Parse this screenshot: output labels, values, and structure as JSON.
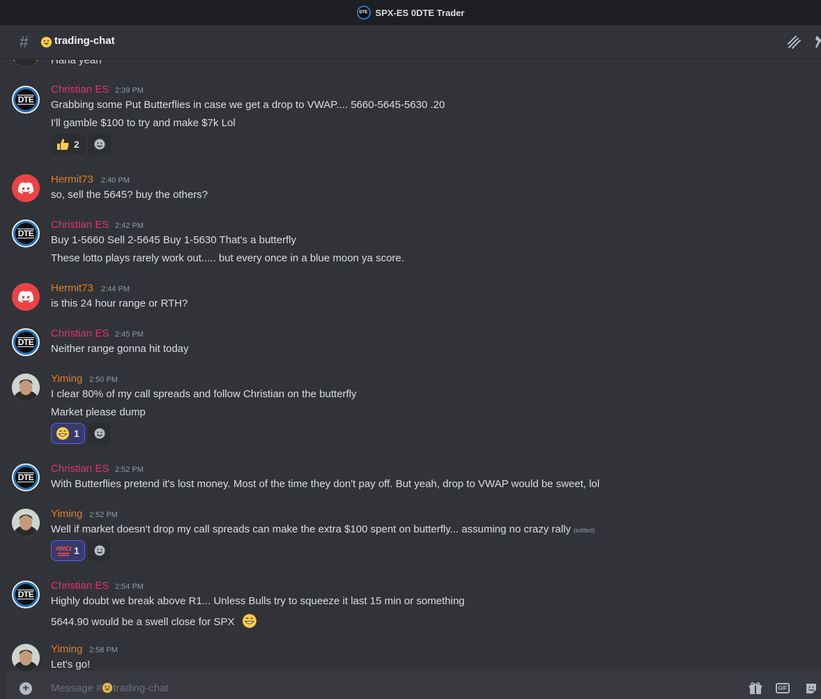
{
  "window": {
    "title": "SPX-ES 0DTE Trader",
    "server_icon_text": "DTE"
  },
  "channel": {
    "name": "trading-chat",
    "emoji": "😀"
  },
  "messages": [
    {
      "text": "Haha yeah"
    },
    {
      "author": "Christian ES",
      "time": "2:39 PM",
      "lines": [
        "Grabbing some Put Butterflies in case we get a drop to VWAP....  5660-5645-5630  .20",
        "I'll gamble $100 to try and make $7k   Lol"
      ],
      "reaction": {
        "emoji": "👍",
        "count": "2"
      }
    },
    {
      "author": "Hermit73",
      "time": "2:40 PM",
      "lines": [
        "so, sell the 5645?  buy the others?"
      ]
    },
    {
      "author": "Christian ES",
      "time": "2:42 PM",
      "lines": [
        "Buy 1-5660   Sell 2-5645   Buy 1-5630   That's a butterfly",
        "These lotto plays rarely work out..... but every once in a blue moon ya score."
      ]
    },
    {
      "author": "Hermit73",
      "time": "2:44 PM",
      "lines": [
        "is this 24 hour range or RTH?"
      ]
    },
    {
      "author": "Christian ES",
      "time": "2:45 PM",
      "lines": [
        "Neither range gonna hit today"
      ]
    },
    {
      "author": "Yiming",
      "time": "2:50 PM",
      "lines": [
        "I clear 80% of my call spreads and follow Christian on the butterfly",
        "Market please dump"
      ],
      "reaction": {
        "emoji": "😁",
        "count": "1"
      }
    },
    {
      "author": "Christian ES",
      "time": "2:52 PM",
      "lines": [
        "With Butterflies pretend it's lost money. Most of the time they don't pay off. But yeah, drop to VWAP would be sweet, lol"
      ]
    },
    {
      "author": "Yiming",
      "time": "2:52 PM",
      "lines": [
        "Well if market doesn't drop my call spreads can make the extra $100 spent on butterfly... assuming no crazy rally"
      ],
      "edited": "(edited)",
      "reaction": {
        "emoji": "VOICE",
        "count": "1"
      }
    },
    {
      "author": "Christian ES",
      "time": "2:54 PM",
      "lines": [
        "Highly doubt we break above R1... Unless Bulls try to squeeze it last 15 min or something",
        "5644.90 would be a swell close for SPX"
      ],
      "inline_emoji": "😁"
    },
    {
      "author": "Yiming",
      "time": "2:58 PM",
      "lines": [
        "Let's go!"
      ]
    }
  ],
  "composer": {
    "placeholder_prefix": "Message #",
    "placeholder_emoji": "😀",
    "placeholder_channel": "trading-chat",
    "gif_label": "GIF"
  },
  "colors": {
    "christian": "#e7326b",
    "hermit": "#e67e22",
    "yiming": "#e67e22",
    "background": "#313338"
  },
  "icons": [
    "hash-icon",
    "threads-icon",
    "pin-icon",
    "discord-icon",
    "add-reaction-icon",
    "plus-icon",
    "gift-icon",
    "gif-icon",
    "sticker-icon"
  ]
}
